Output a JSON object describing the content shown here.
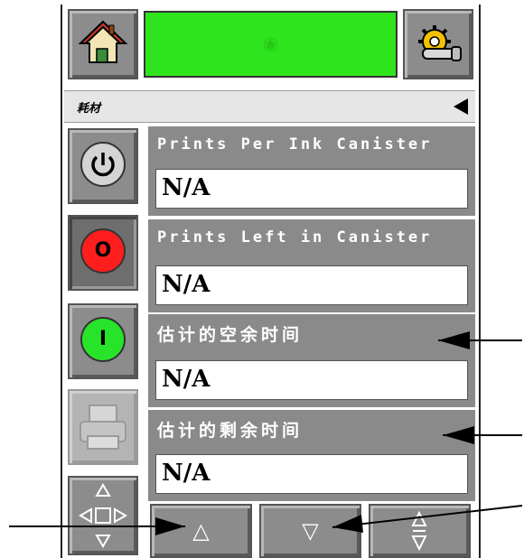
{
  "top_bar": {
    "home_icon": "home-icon",
    "settings_icon": "gear-wrench-icon",
    "status_color": "#2ee51d"
  },
  "title_bar": {
    "title": "耗材",
    "back_icon": "triangle-left-icon"
  },
  "left_buttons": [
    {
      "name": "power-button",
      "icon": "power-icon",
      "glyph": "⏻",
      "color": "#cfcfcf"
    },
    {
      "name": "stop-button",
      "icon": "stop-o-icon",
      "glyph": "O",
      "color": "#ff2020"
    },
    {
      "name": "start-button",
      "icon": "start-i-icon",
      "glyph": "I",
      "color": "#28e42a"
    },
    {
      "name": "print-button",
      "icon": "printer-icon",
      "disabled": true
    },
    {
      "name": "navigate-button",
      "icon": "four-way-arrows-icon"
    }
  ],
  "panels": [
    {
      "label": "Prints Per Ink Canister",
      "value": "N/A"
    },
    {
      "label": "Prints Left in Canister",
      "value": "N/A"
    },
    {
      "label": "估计的空余时间",
      "value": "N/A"
    },
    {
      "label": "估计的剩余时间",
      "value": "N/A"
    }
  ],
  "bottom_nav": [
    {
      "name": "scroll-up-button",
      "icon": "up-triangle-icon",
      "glyph": "△"
    },
    {
      "name": "scroll-down-button",
      "icon": "down-triangle-icon",
      "glyph": "▽"
    },
    {
      "name": "scroll-updown-button",
      "icon": "up-down-triangles-icon",
      "glyph": "⇕"
    }
  ]
}
